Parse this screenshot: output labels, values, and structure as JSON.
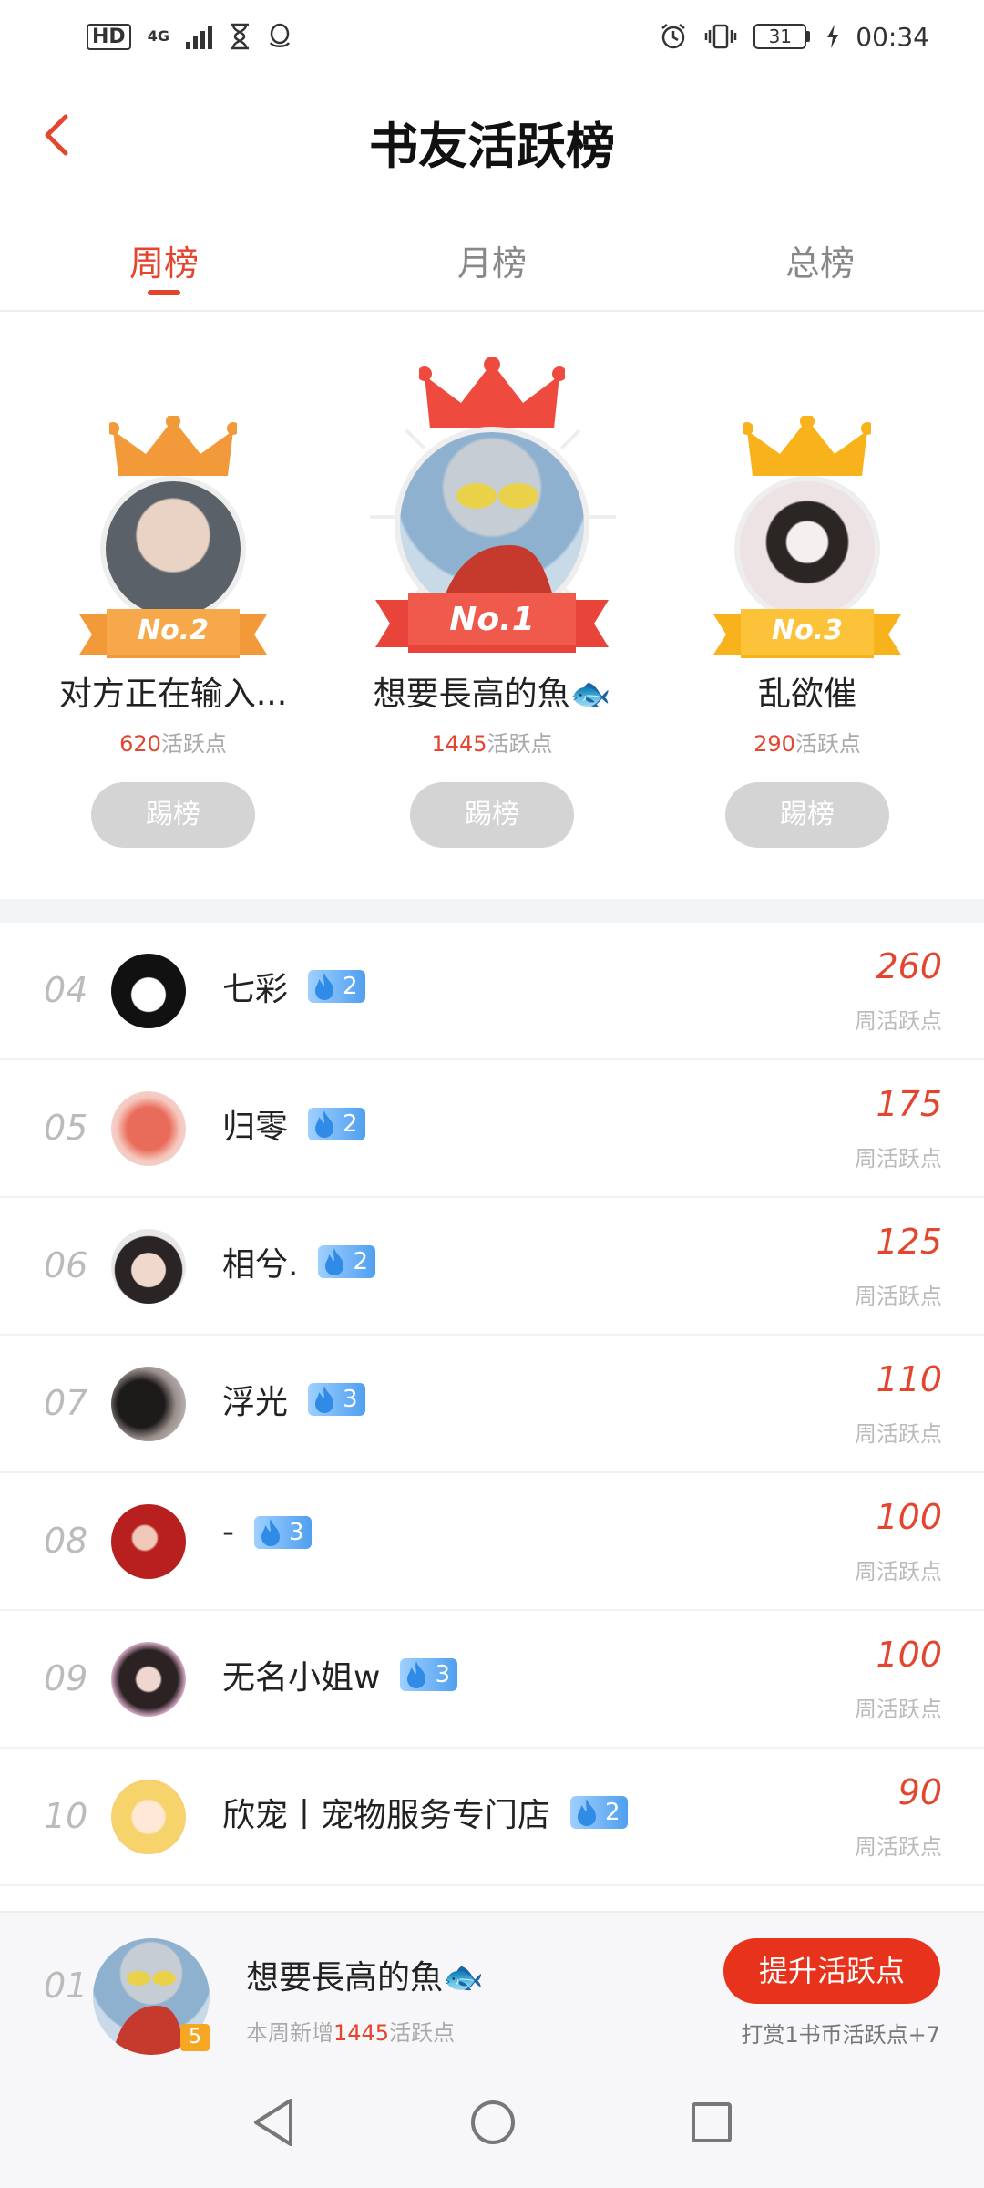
{
  "status_bar": {
    "hd": "HD",
    "network": "4G",
    "battery": "31",
    "time": "00:34"
  },
  "header": {
    "title": "书友活跃榜",
    "back_icon": "chevron-left-icon"
  },
  "tabs": [
    {
      "label": "周榜",
      "active": true
    },
    {
      "label": "月榜",
      "active": false
    },
    {
      "label": "总榜",
      "active": false
    }
  ],
  "podium": {
    "first": {
      "rank_label": "No.1",
      "name": "想要長高的魚🐟",
      "points": "1445",
      "points_unit": "活跃点",
      "button": "踢榜"
    },
    "second": {
      "rank_label": "No.2",
      "name": "对方正在输入...",
      "points": "620",
      "points_unit": "活跃点",
      "button": "踢榜"
    },
    "third": {
      "rank_label": "No.3",
      "name": "乱欲催",
      "points": "290",
      "points_unit": "活跃点",
      "button": "踢榜"
    }
  },
  "list": [
    {
      "rank": "04",
      "name": "七彩",
      "level": "2",
      "score": "260",
      "score_label": "周活跃点"
    },
    {
      "rank": "05",
      "name": "归零",
      "level": "2",
      "score": "175",
      "score_label": "周活跃点"
    },
    {
      "rank": "06",
      "name": "相兮.",
      "level": "2",
      "score": "125",
      "score_label": "周活跃点"
    },
    {
      "rank": "07",
      "name": "浮光",
      "level": "3",
      "score": "110",
      "score_label": "周活跃点"
    },
    {
      "rank": "08",
      "name": "-",
      "level": "3",
      "score": "100",
      "score_label": "周活跃点"
    },
    {
      "rank": "09",
      "name": "无名小姐w",
      "level": "3",
      "score": "100",
      "score_label": "周活跃点"
    },
    {
      "rank": "10",
      "name": "欣宠丨宠物服务专门店",
      "level": "2",
      "score": "90",
      "score_label": "周活跃点"
    }
  ],
  "self": {
    "rank": "01",
    "name": "想要長高的魚🐟",
    "level": "5",
    "sub_prefix": "本周新增",
    "sub_points": "1445",
    "sub_suffix": "活跃点",
    "boost_button": "提升活跃点",
    "hint": "打赏1书币活跃点+7"
  },
  "colors": {
    "accent": "#e3452f",
    "gold": "#f5a623",
    "silver_crown": "#f29a3a"
  }
}
